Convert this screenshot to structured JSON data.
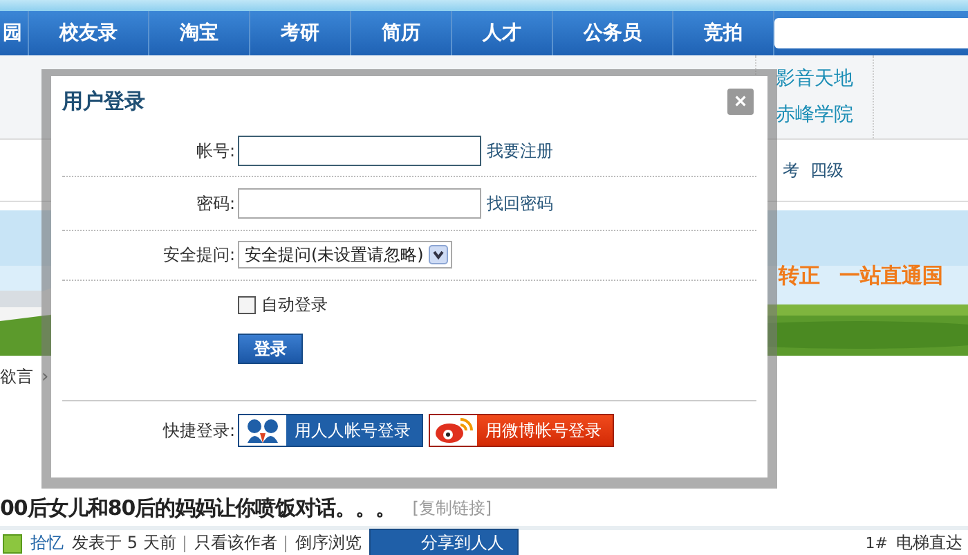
{
  "nav": {
    "items": [
      {
        "label": "园",
        "selected": false
      },
      {
        "label": "校友录",
        "selected": false
      },
      {
        "label": "淘宝",
        "selected": false
      },
      {
        "label": "考研",
        "selected": false
      },
      {
        "label": "简历",
        "selected": false
      },
      {
        "label": "人才",
        "selected": false
      },
      {
        "label": "公务员",
        "selected": false
      },
      {
        "label": "竞拍",
        "selected": false
      }
    ]
  },
  "subnav": {
    "links": [
      "影音天地",
      "赤峰学院"
    ]
  },
  "tags": [
    "考",
    "四级"
  ],
  "banner": {
    "kind": "picture",
    "texts": [
      "转正",
      "一站直通国"
    ]
  },
  "breadcrumb": {
    "text": "欲言",
    "separator": "›"
  },
  "thread": {
    "title": "00后女儿和80后的妈妈让你喷饭对话。。。",
    "copy_link": "[复制链接]",
    "author": "拾忆",
    "posted": "发表于 5 天前",
    "only_author": "只看该作者",
    "reverse": "倒序浏览",
    "share": "分享到人人",
    "floor": "1#",
    "jump": "电梯直达"
  },
  "dialog": {
    "title": "用户登录",
    "close": "×",
    "account": {
      "label": "帐号:",
      "link": "我要注册"
    },
    "password": {
      "label": "密码:",
      "link": "找回密码"
    },
    "question": {
      "label": "安全提问:",
      "value": "安全提问(未设置请忽略)"
    },
    "auto_login": {
      "label": "自动登录",
      "checked": false
    },
    "submit": "登录",
    "quick": {
      "label": "快捷登录:",
      "buttons": [
        {
          "kind": "renren",
          "label": "用人人帐号登录"
        },
        {
          "kind": "weibo",
          "label": "用微博帐号登录"
        }
      ]
    }
  }
}
